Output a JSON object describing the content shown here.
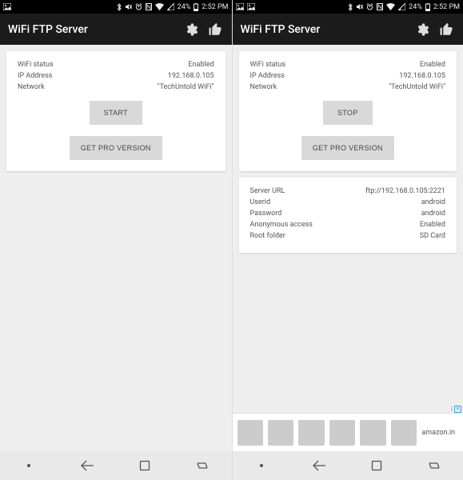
{
  "left": {
    "statusbar": {
      "battery": "24%",
      "time": "2:52 PM"
    },
    "appbar": {
      "title": "WiFi FTP Server"
    },
    "status": {
      "wifi_label": "WiFi status",
      "wifi_value": "Enabled",
      "ip_label": "IP Address",
      "ip_value": "192.168.0.105",
      "net_label": "Network",
      "net_value": "\"TechUntold WiFi\""
    },
    "buttons": {
      "primary": "START",
      "secondary": "GET PRO VERSION"
    }
  },
  "right": {
    "statusbar": {
      "battery": "24%",
      "time": "2:52 PM"
    },
    "appbar": {
      "title": "WiFi FTP Server"
    },
    "status": {
      "wifi_label": "WiFi status",
      "wifi_value": "Enabled",
      "ip_label": "IP Address",
      "ip_value": "192.168.0.105",
      "net_label": "Network",
      "net_value": "\"TechUntold WiFi\""
    },
    "buttons": {
      "primary": "STOP",
      "secondary": "GET PRO VERSION"
    },
    "server": {
      "url_label": "Server URL",
      "url_value": "ftp://192.168.0.105:2221",
      "user_label": "Userid",
      "user_value": "android",
      "pass_label": "Password",
      "pass_value": "android",
      "anon_label": "Anonymous access",
      "anon_value": "Enabled",
      "root_label": "Root folder",
      "root_value": "SD Card"
    },
    "ad": {
      "brand": "amazon.in",
      "choices": "i"
    }
  }
}
